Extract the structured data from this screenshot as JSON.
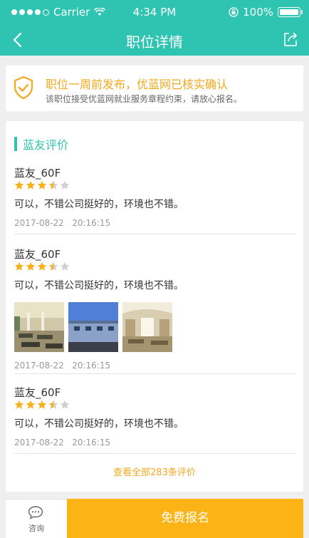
{
  "status_bar": {
    "carrier": "Carrier",
    "time": "4:34 PM",
    "battery": "100%"
  },
  "nav": {
    "title": "职位详情"
  },
  "verify": {
    "title": "职位一周前发布，优蓝网已核实确认",
    "subtitle": "该职位接受优蓝网就业服务章程约束，请放心报名。"
  },
  "reviews_section": {
    "title": "蓝友评价",
    "items": [
      {
        "user": "蓝友_60F",
        "rating": 3.5,
        "text": "可以，不错公司挺好的，环境也不错。",
        "date": "2017-08-22",
        "time": "20:16:15"
      },
      {
        "user": "蓝友_60F",
        "rating": 3.5,
        "text": "可以，不错公司挺好的，环境也不错。",
        "date": "2017-08-22",
        "time": "20:16:15",
        "photos": [
          "canteen-photo",
          "factory-building-photo",
          "office-interior-photo"
        ]
      },
      {
        "user": "蓝友_60F",
        "rating": 3.5,
        "text": "可以，不错公司挺好的，环境也不错。",
        "date": "2017-08-22",
        "time": "20:16:15"
      }
    ],
    "more_link": "查看全部283条评价"
  },
  "bottom_bar": {
    "consult_label": "咨询",
    "apply_label": "免费报名"
  },
  "colors": {
    "brand": "#2fc4b2",
    "accent": "#fbb316",
    "verify_text": "#f4a81c",
    "star": "#f7b21b"
  }
}
